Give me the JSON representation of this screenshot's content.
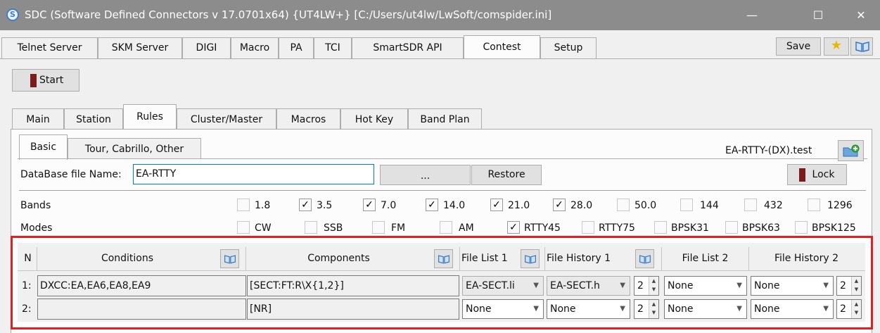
{
  "window": {
    "title": "SDC (Software Defined Connectors v 17.0701x64) {UT4LW+} [C:/Users/ut4lw/LwSoft/comspider.ini]",
    "app_icon": "S",
    "minimize": "—",
    "maximize": "☐",
    "close": "✕"
  },
  "top_tabs": [
    "Telnet Server",
    "SKM Server",
    "DIGI",
    "Macro",
    "PA",
    "TCI",
    "SmartSDR API",
    "Contest",
    "Setup"
  ],
  "toolbar": {
    "save_label": "Save",
    "star_icon": "★"
  },
  "start_label": "Start",
  "inner_tabs": [
    "Main",
    "Station",
    "Rules",
    "Cluster/Master",
    "Macros",
    "Hot Key",
    "Band Plan"
  ],
  "sub_tabs": [
    "Basic",
    "Tour, Cabrillo, Other"
  ],
  "rules_file": "EA-RTTY-(DX).test",
  "db": {
    "label": "DataBase file Name:",
    "value": "EA-RTTY",
    "browse_label": "...",
    "restore_label": "Restore",
    "lock_label": "Lock"
  },
  "bands": {
    "label": "Bands",
    "items": [
      {
        "label": "1.8",
        "checked": false,
        "mark": ""
      },
      {
        "label": "3.5",
        "checked": true,
        "mark": "✓"
      },
      {
        "label": "7.0",
        "checked": true,
        "mark": "✓"
      },
      {
        "label": "14.0",
        "checked": true,
        "mark": "✓"
      },
      {
        "label": "21.0",
        "checked": true,
        "mark": "✓"
      },
      {
        "label": "28.0",
        "checked": true,
        "mark": "✓"
      },
      {
        "label": "50.0",
        "checked": false,
        "mark": ""
      },
      {
        "label": "144",
        "checked": false,
        "mark": ""
      },
      {
        "label": "432",
        "checked": false,
        "mark": ""
      },
      {
        "label": "1296",
        "checked": false,
        "mark": ""
      }
    ]
  },
  "modes": {
    "label": "Modes",
    "items": [
      {
        "label": "CW",
        "checked": false,
        "mark": ""
      },
      {
        "label": "SSB",
        "checked": false,
        "mark": ""
      },
      {
        "label": "FM",
        "checked": false,
        "mark": ""
      },
      {
        "label": "AM",
        "checked": false,
        "mark": ""
      },
      {
        "label": "RTTY45",
        "checked": true,
        "mark": "✓"
      },
      {
        "label": "RTTY75",
        "checked": false,
        "mark": ""
      },
      {
        "label": "BPSK31",
        "checked": false,
        "mark": ""
      },
      {
        "label": "BPSK63",
        "checked": false,
        "mark": ""
      },
      {
        "label": "BPSK125",
        "checked": false,
        "mark": ""
      }
    ]
  },
  "grid": {
    "headers": {
      "n": "N",
      "conditions": "Conditions",
      "components": "Components",
      "file_list_1": "File List 1",
      "file_history_1": "File History 1",
      "file_list_2": "File List 2",
      "file_history_2": "File History 2"
    },
    "rows": [
      {
        "n": "1:",
        "conditions": "DXCC:EA,EA6,EA8,EA9",
        "components": "[SECT:FT:R\\X{1,2}]",
        "file_list_1": "EA-SECT.li",
        "file_history_1": "EA-SECT.h",
        "spin1": "2",
        "file_list_2": "None",
        "file_history_2": "None",
        "spin2": "2"
      },
      {
        "n": "2:",
        "conditions": "",
        "components": "[NR]",
        "file_list_1": "None",
        "file_history_1": "None",
        "spin1": "2",
        "file_list_2": "None",
        "file_history_2": "None",
        "spin2": "2"
      }
    ]
  },
  "icons": {
    "dropdown": "▼",
    "spin_up": "▲",
    "spin_down": "▼"
  },
  "colors": {
    "highlight_box": "#e02020",
    "title_bar": "#8c8c8c",
    "start_mark": "#7a1c1c"
  }
}
